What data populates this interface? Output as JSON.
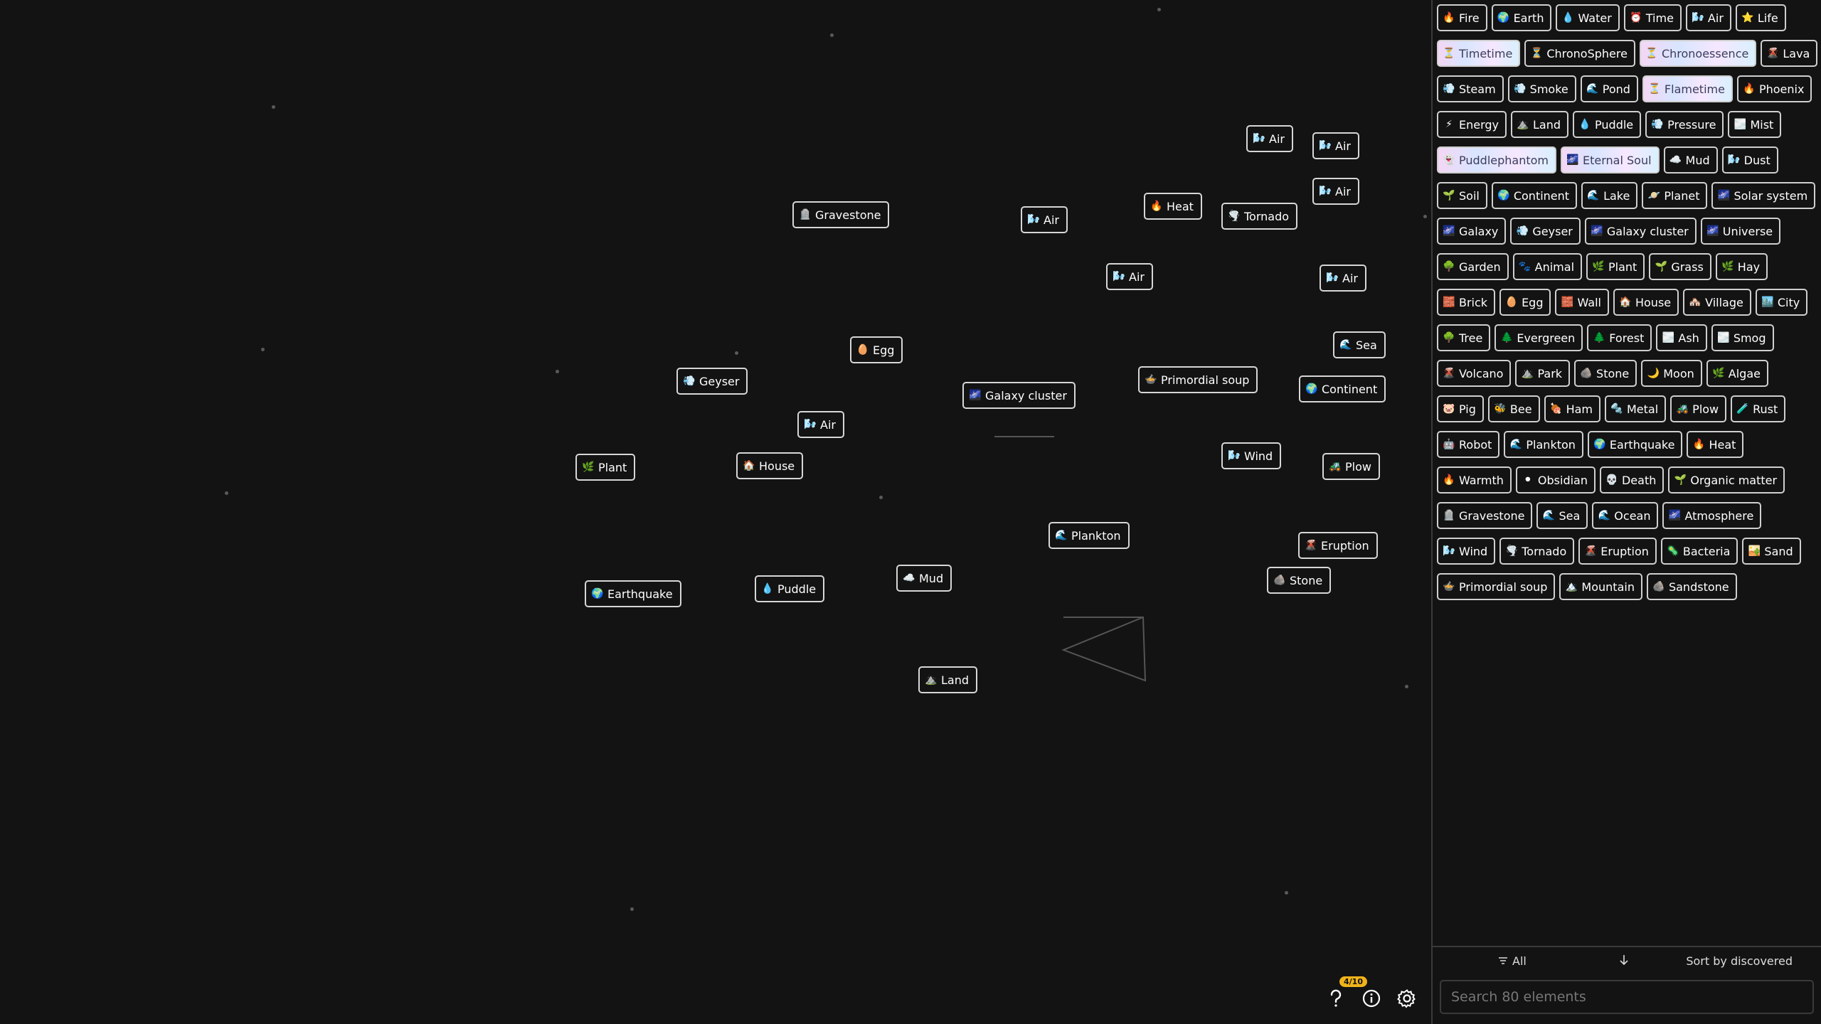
{
  "canvas": {
    "items": [
      {
        "label": "Gravestone",
        "icon": "gravestone-icon"
      },
      {
        "label": "Air",
        "icon": "air-icon"
      },
      {
        "label": "Heat",
        "icon": "fire-icon"
      },
      {
        "label": "Tornado",
        "icon": "tornado-icon"
      },
      {
        "label": "Air",
        "icon": "air-icon"
      },
      {
        "label": "Air",
        "icon": "air-icon"
      },
      {
        "label": "Air",
        "icon": "air-icon"
      },
      {
        "label": "Air",
        "icon": "air-icon"
      },
      {
        "label": "Air",
        "icon": "air-icon"
      },
      {
        "label": "Egg",
        "icon": "egg-icon"
      },
      {
        "label": "Sea",
        "icon": "wave-icon"
      },
      {
        "label": "Geyser",
        "icon": "steam-icon"
      },
      {
        "label": "Primordial soup",
        "icon": "soup-icon"
      },
      {
        "label": "Continent",
        "icon": "globe-icon"
      },
      {
        "label": "Galaxy cluster",
        "icon": "galaxy-icon"
      },
      {
        "label": "Air",
        "icon": "air-icon"
      },
      {
        "label": "Plant",
        "icon": "plant-icon"
      },
      {
        "label": "House",
        "icon": "house-icon"
      },
      {
        "label": "Wind",
        "icon": "air-icon"
      },
      {
        "label": "Plow",
        "icon": "plow-icon"
      },
      {
        "label": "Plankton",
        "icon": "wave-icon"
      },
      {
        "label": "Eruption",
        "icon": "volcano-icon"
      },
      {
        "label": "Mud",
        "icon": "cloud-icon"
      },
      {
        "label": "Stone",
        "icon": "stone-icon"
      },
      {
        "label": "Earthquake",
        "icon": "globe-icon"
      },
      {
        "label": "Puddle",
        "icon": "droplet-icon"
      },
      {
        "label": "Land",
        "icon": "land-icon"
      }
    ]
  },
  "sidebar": {
    "items": [
      {
        "label": "Fire",
        "icon": "fire-icon"
      },
      {
        "label": "Earth",
        "icon": "globe-icon"
      },
      {
        "label": "Water",
        "icon": "droplet-icon"
      },
      {
        "label": "Time",
        "icon": "clock-icon"
      },
      {
        "label": "Air",
        "icon": "air-icon"
      },
      {
        "label": "Life",
        "icon": "star-icon"
      },
      {
        "label": "Timetime",
        "icon": "hourglass-icon",
        "special": true
      },
      {
        "label": "ChronoSphere",
        "icon": "hourglass-icon"
      },
      {
        "label": "Chronoessence",
        "icon": "hourglass-icon",
        "special": true
      },
      {
        "label": "Lava",
        "icon": "volcano-icon"
      },
      {
        "label": "Steam",
        "icon": "steam-icon"
      },
      {
        "label": "Smoke",
        "icon": "steam-icon"
      },
      {
        "label": "Pond",
        "icon": "wave-icon"
      },
      {
        "label": "Flametime",
        "icon": "hourglass-icon",
        "special": true
      },
      {
        "label": "Phoenix",
        "icon": "fire-icon"
      },
      {
        "label": "Energy",
        "icon": "lightning-icon"
      },
      {
        "label": "Land",
        "icon": "land-icon"
      },
      {
        "label": "Puddle",
        "icon": "droplet-icon"
      },
      {
        "label": "Pressure",
        "icon": "steam-icon"
      },
      {
        "label": "Mist",
        "icon": "fog-icon"
      },
      {
        "label": "Puddlephantom",
        "icon": "ghost-icon",
        "special": true
      },
      {
        "label": "Eternal Soul",
        "icon": "galaxy-icon",
        "special": true
      },
      {
        "label": "Mud",
        "icon": "cloud-icon"
      },
      {
        "label": "Dust",
        "icon": "air-icon"
      },
      {
        "label": "Soil",
        "icon": "sprout-icon"
      },
      {
        "label": "Continent",
        "icon": "globe-icon"
      },
      {
        "label": "Lake",
        "icon": "wave-icon"
      },
      {
        "label": "Planet",
        "icon": "planet-icon"
      },
      {
        "label": "Solar system",
        "icon": "galaxy-icon"
      },
      {
        "label": "Galaxy",
        "icon": "galaxy-icon"
      },
      {
        "label": "Geyser",
        "icon": "steam-icon"
      },
      {
        "label": "Galaxy cluster",
        "icon": "galaxy-icon"
      },
      {
        "label": "Universe",
        "icon": "galaxy-icon"
      },
      {
        "label": "Garden",
        "icon": "tree-icon"
      },
      {
        "label": "Animal",
        "icon": "paw-icon"
      },
      {
        "label": "Plant",
        "icon": "plant-icon"
      },
      {
        "label": "Grass",
        "icon": "sprout-icon"
      },
      {
        "label": "Hay",
        "icon": "plant-icon"
      },
      {
        "label": "Brick",
        "icon": "brick-icon"
      },
      {
        "label": "Egg",
        "icon": "egg-icon"
      },
      {
        "label": "Wall",
        "icon": "brick-icon"
      },
      {
        "label": "House",
        "icon": "house-icon"
      },
      {
        "label": "Village",
        "icon": "village-icon"
      },
      {
        "label": "City",
        "icon": "city-icon"
      },
      {
        "label": "Tree",
        "icon": "tree-icon"
      },
      {
        "label": "Evergreen",
        "icon": "evergreen-icon"
      },
      {
        "label": "Forest",
        "icon": "evergreen-icon"
      },
      {
        "label": "Ash",
        "icon": "fog-icon"
      },
      {
        "label": "Smog",
        "icon": "fog-icon"
      },
      {
        "label": "Volcano",
        "icon": "volcano-icon"
      },
      {
        "label": "Park",
        "icon": "land-icon"
      },
      {
        "label": "Stone",
        "icon": "stone-icon"
      },
      {
        "label": "Moon",
        "icon": "moon-icon"
      },
      {
        "label": "Algae",
        "icon": "plant-icon"
      },
      {
        "label": "Pig",
        "icon": "pig-icon"
      },
      {
        "label": "Bee",
        "icon": "bee-icon"
      },
      {
        "label": "Ham",
        "icon": "ham-icon"
      },
      {
        "label": "Metal",
        "icon": "metal-icon"
      },
      {
        "label": "Plow",
        "icon": "plow-icon"
      },
      {
        "label": "Rust",
        "icon": "rust-icon"
      },
      {
        "label": "Robot",
        "icon": "robot-icon"
      },
      {
        "label": "Plankton",
        "icon": "wave-icon"
      },
      {
        "label": "Earthquake",
        "icon": "globe-icon"
      },
      {
        "label": "Heat",
        "icon": "fire-icon"
      },
      {
        "label": "Warmth",
        "icon": "fire-icon"
      },
      {
        "label": "Obsidian",
        "icon": "dark-circle-icon"
      },
      {
        "label": "Death",
        "icon": "skull-icon"
      },
      {
        "label": "Organic matter",
        "icon": "sprout-icon"
      },
      {
        "label": "Gravestone",
        "icon": "gravestone-icon"
      },
      {
        "label": "Sea",
        "icon": "wave-icon"
      },
      {
        "label": "Ocean",
        "icon": "wave-icon"
      },
      {
        "label": "Atmosphere",
        "icon": "galaxy-icon"
      },
      {
        "label": "Wind",
        "icon": "air-icon"
      },
      {
        "label": "Tornado",
        "icon": "tornado-icon"
      },
      {
        "label": "Eruption",
        "icon": "volcano-icon"
      },
      {
        "label": "Bacteria",
        "icon": "pill-icon"
      },
      {
        "label": "Sand",
        "icon": "sand-icon"
      },
      {
        "label": "Primordial soup",
        "icon": "soup-icon"
      },
      {
        "label": "Mountain",
        "icon": "mountain-icon"
      },
      {
        "label": "Sandstone",
        "icon": "stone-icon"
      }
    ],
    "toolbar": {
      "filter_label": "All",
      "sort_label": "Sort by discovered"
    },
    "search": {
      "placeholder": "Search 80 elements"
    }
  },
  "controls": {
    "badge": "4/10"
  }
}
